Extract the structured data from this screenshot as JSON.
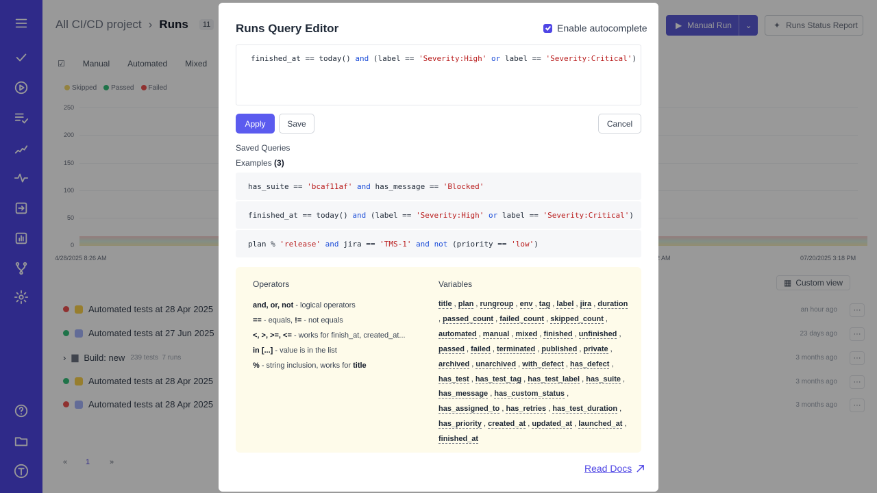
{
  "background": {
    "breadcrumb": "All CI/CD project",
    "page_title": "Runs",
    "run_count": "11",
    "manual_run_label": "Manual Run",
    "status_report_label": "Runs Status Report",
    "tabs": [
      "Manual",
      "Automated",
      "Mixed"
    ],
    "legend": [
      {
        "label": "Skipped",
        "color": "#f5d96b"
      },
      {
        "label": "Passed",
        "color": "#34c07a"
      },
      {
        "label": "Failed",
        "color": "#ef5350"
      }
    ],
    "chart_data": {
      "type": "area",
      "yticks": [
        250,
        200,
        150,
        100,
        50,
        0
      ],
      "x_labels": [
        "4/28/2025 8:26 AM",
        "2 AM",
        "07/20/2025 3:18 PM"
      ]
    },
    "custom_view_label": "Custom view",
    "rows": [
      {
        "title": "Automated tests at 28 Apr 2025",
        "time": "an hour ago",
        "status": "#ef5350"
      },
      {
        "title": "Automated tests at 27 Jun 2025",
        "time": "23 days ago",
        "status": "#34c07a"
      },
      {
        "title": "Build: new",
        "meta": "239 tests  7 runs",
        "time": "3 months ago"
      },
      {
        "title": "Automated tests at 28 Apr 2025",
        "time": "3 months ago",
        "status": "#34c07a"
      },
      {
        "title": "Automated tests at 28 Apr 2025",
        "time": "3 months ago",
        "status": "#ef5350"
      }
    ],
    "more_label": "···",
    "pager": {
      "prev": "«",
      "page": "1",
      "next": "»"
    }
  },
  "modal": {
    "title": "Runs Query Editor",
    "autocomplete_label": "Enable autocomplete",
    "autocomplete_checked": true,
    "editor_query": "finished_at == today() and (label == 'Severity:High' or label == 'Severity:Critical')",
    "apply_label": "Apply",
    "save_label": "Save",
    "cancel_label": "Cancel",
    "saved_queries_label": "Saved Queries",
    "examples_label": "Examples",
    "examples_count": "(3)",
    "examples": [
      "has_suite == 'bcaf11af' and has_message == 'Blocked'",
      "finished_at == today() and (label == 'Severity:High' or label == 'Severity:Critical')",
      "plan % 'release' and jira == 'TMS-1' and not (priority == 'low')"
    ],
    "operators_heading": "Operators",
    "variables_heading": "Variables",
    "operators": [
      {
        "ops": "and, or, not",
        "desc": " - logical operators"
      },
      {
        "ops": "==",
        "desc": " - equals, ",
        "ops2": "!=",
        "desc2": " - not equals"
      },
      {
        "ops": "<, >, >=, <=",
        "desc": " - works for finish_at, created_at..."
      },
      {
        "ops": "in [...]",
        "desc": " - value is in the list"
      },
      {
        "ops": "%",
        "desc": " - string inclusion, works for ",
        "ops2": "title",
        "desc2": ""
      }
    ],
    "variables": [
      "title",
      "plan",
      "rungroup",
      "env",
      "tag",
      "label",
      "jira",
      "duration",
      "passed_count",
      "failed_count",
      "skipped_count",
      "automated",
      "manual",
      "mixed",
      "finished",
      "unfinished",
      "passed",
      "failed",
      "terminated",
      "published",
      "private",
      "archived",
      "unarchived",
      "with_defect",
      "has_defect",
      "has_test",
      "has_test_tag",
      "has_test_label",
      "has_suite",
      "has_message",
      "has_custom_status",
      "has_assigned_to",
      "has_retries",
      "has_test_duration",
      "has_priority",
      "created_at",
      "updated_at",
      "launched_at",
      "finished_at"
    ],
    "read_docs_label": "Read Docs"
  }
}
